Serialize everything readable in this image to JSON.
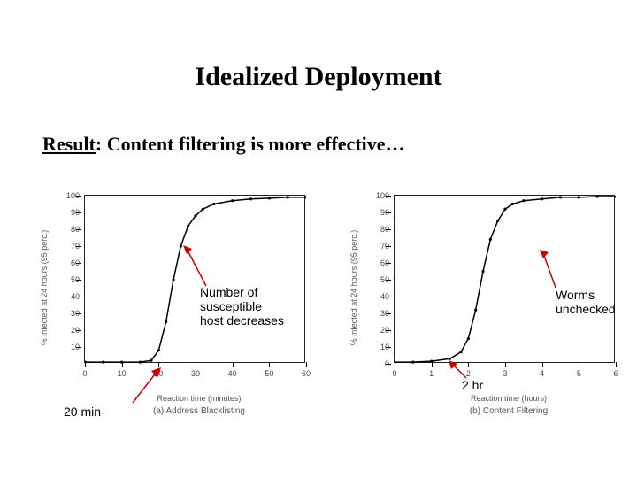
{
  "title": "Idealized Deployment",
  "subtitle_underlined": "Result",
  "subtitle_rest": ": Content filtering is more effective…",
  "annotations": {
    "left_curve": "Number of\nsusceptible\nhost decreases",
    "right_curve": "Worms\nunchecked",
    "left_x": "20 min",
    "right_x": "2 hr"
  },
  "chart_data": [
    {
      "type": "line",
      "title": "",
      "xlabel": "Reaction time (minutes)",
      "ylabel": "% infected at 24 hours (95 perc.)",
      "caption": "(a) Address Blacklisting",
      "xlim": [
        0,
        60
      ],
      "ylim": [
        0,
        100
      ],
      "x_ticks": [
        0,
        10,
        20,
        30,
        40,
        50,
        60
      ],
      "y_ticks": [
        10,
        20,
        30,
        40,
        50,
        60,
        70,
        80,
        90,
        100
      ],
      "x": [
        0,
        5,
        10,
        15,
        18,
        20,
        22,
        24,
        26,
        28,
        30,
        32,
        35,
        40,
        45,
        50,
        55,
        60
      ],
      "values": [
        1,
        1,
        1,
        1,
        2,
        8,
        25,
        50,
        70,
        82,
        88,
        92,
        95,
        97,
        98,
        98.5,
        99,
        99
      ]
    },
    {
      "type": "line",
      "title": "",
      "xlabel": "Reaction time (hours)",
      "ylabel": "% infected at 24 hours (95 perc.)",
      "caption": "(b) Content Filtering",
      "xlim": [
        0,
        6
      ],
      "ylim": [
        0,
        100
      ],
      "x_ticks": [
        0,
        1,
        2,
        3,
        4,
        5,
        6
      ],
      "y_ticks": [
        0,
        10,
        20,
        30,
        40,
        50,
        60,
        70,
        80,
        90,
        100
      ],
      "x": [
        0,
        0.5,
        1,
        1.5,
        1.8,
        2,
        2.2,
        2.4,
        2.6,
        2.8,
        3,
        3.2,
        3.5,
        4,
        4.5,
        5,
        5.5,
        6
      ],
      "values": [
        1,
        1,
        1.5,
        3,
        7,
        15,
        32,
        55,
        74,
        85,
        92,
        95,
        97,
        98,
        99,
        99,
        99.5,
        99.5
      ]
    }
  ]
}
